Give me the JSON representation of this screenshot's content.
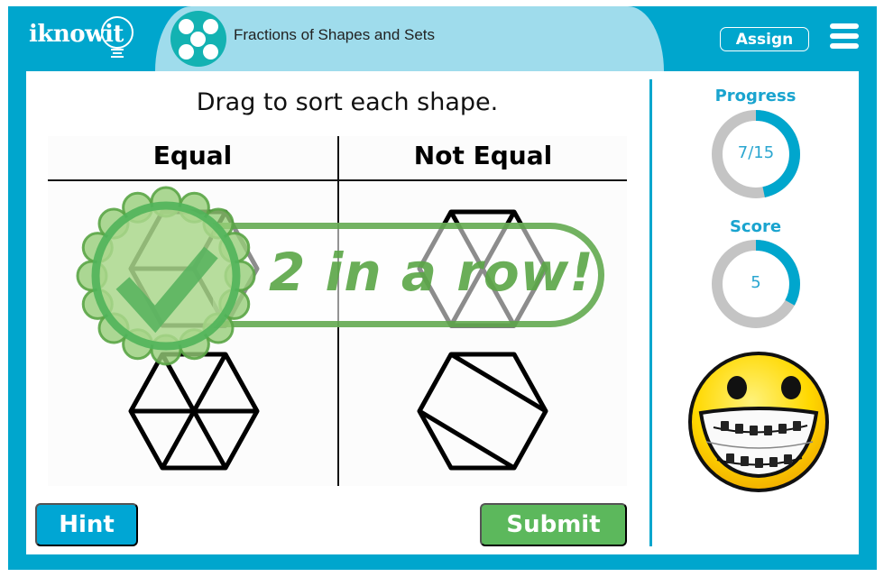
{
  "header": {
    "logo_text": "iknowit",
    "lesson_title": "Fractions of Shapes and Sets",
    "lesson_icon": "five-dots-icon",
    "assign_label": "Assign",
    "menu_icon": "hamburger-menu-icon"
  },
  "activity": {
    "instruction": "Drag to sort each shape.",
    "columns": [
      {
        "label": "Equal",
        "shapes": [
          {
            "description": "hexagon divided into 3 rhombi"
          },
          {
            "description": "hexagon divided into 6 triangles"
          }
        ]
      },
      {
        "label": "Not Equal",
        "shapes": [
          {
            "description": "hexagon with two crossing diagonals"
          },
          {
            "description": "hexagon divided by two parallel lines"
          }
        ]
      }
    ]
  },
  "streak": {
    "message": "2 in a row!",
    "badge_icon": "checkmark-badge-icon"
  },
  "sidebar": {
    "progress": {
      "label": "Progress",
      "text": "7/15",
      "current": 7,
      "total": 15
    },
    "score": {
      "label": "Score",
      "text": "5",
      "fill_fraction": 0.33
    },
    "mascot": "smiley-braces-icon"
  },
  "buttons": {
    "hint_label": "Hint",
    "submit_label": "Submit"
  },
  "colors": {
    "brand_blue": "#00a6cd",
    "title_bar": "#9fdcec",
    "icon_teal": "#13b2b2",
    "submit_green": "#5cb85c",
    "streak_green": "#5aa546",
    "ring_gray": "#c4c4c4",
    "ring_blue": "#00a6cd"
  }
}
